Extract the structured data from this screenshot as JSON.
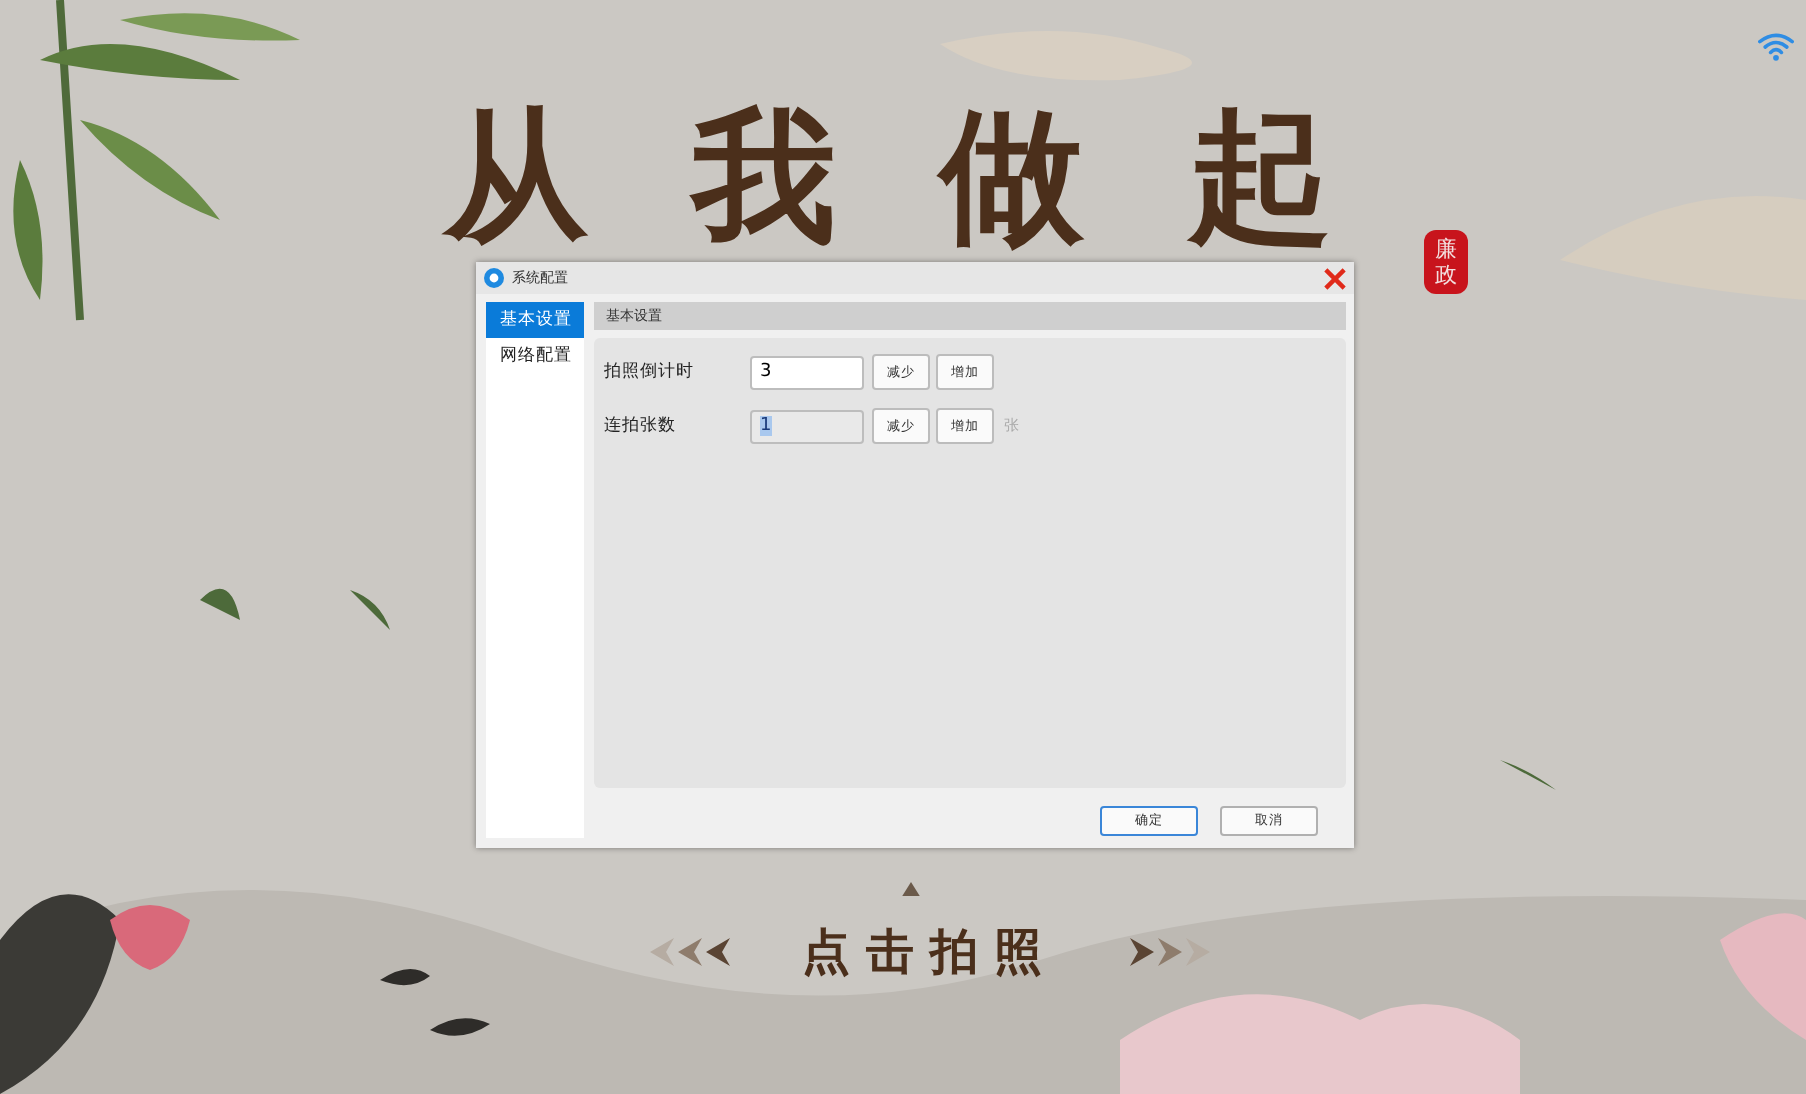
{
  "title": "从我做起",
  "seal": "廉政",
  "capture_label": "点击拍照",
  "dialog": {
    "title": "系统配置",
    "sidebar": [
      {
        "label": "基本设置",
        "selected": true
      },
      {
        "label": "网络配置",
        "selected": false
      }
    ],
    "section_title": "基本设置",
    "settings": [
      {
        "label": "拍照倒计时",
        "value": "3",
        "focused": false,
        "decrease": "减少",
        "increase": "增加"
      },
      {
        "label": "连拍张数",
        "value": "1",
        "focused": true,
        "decrease": "减少",
        "increase": "增加",
        "unit": "张"
      }
    ],
    "buttons": [
      {
        "label": "确定",
        "default": true
      },
      {
        "label": "取消",
        "default": false
      }
    ]
  }
}
